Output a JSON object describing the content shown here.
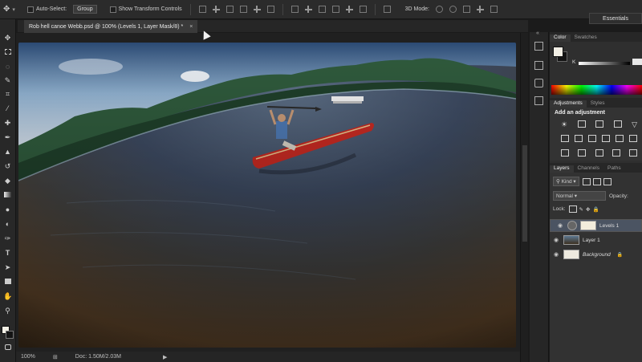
{
  "options_bar": {
    "auto_select_label": "Auto-Select:",
    "target": "Group",
    "transform_label": "Show Transform Controls",
    "mode_label": "3D Mode:",
    "workspace": "Essentials"
  },
  "document": {
    "tab_title": "Rob hell canoe Webb.psd @ 100% (Levels 1, Layer Mask/8) *",
    "close_glyph": "×"
  },
  "status_bar": {
    "zoom": "100%",
    "doc_size": "Doc: 1.50M/2.03M"
  },
  "color_panel": {
    "tabs": [
      "Color",
      "Swatches"
    ],
    "channel_label": "K"
  },
  "adjustments_panel": {
    "tabs": [
      "Adjustments",
      "Styles"
    ],
    "title": "Add an adjustment"
  },
  "layers_panel": {
    "tabs": [
      "Layers",
      "Channels",
      "Paths"
    ],
    "filter": "Kind",
    "blend_mode": "Normal",
    "opacity_label": "Opacity:",
    "lock_label": "Lock:",
    "layers": [
      {
        "name": "Levels 1",
        "selected": true
      },
      {
        "name": "Layer 1",
        "selected": false
      },
      {
        "name": "Background",
        "selected": false
      }
    ]
  },
  "colors": {
    "foreground": "#f2efe5",
    "background": "#141414",
    "canoe": "#c62a22"
  },
  "icons": [
    "move-icon",
    "marquee-icon",
    "lasso-icon",
    "quick-select-icon",
    "crop-icon",
    "eyedropper-icon",
    "healing-icon",
    "brush-icon",
    "stamp-icon",
    "history-brush-icon",
    "eraser-icon",
    "gradient-icon",
    "blur-icon",
    "dodge-icon",
    "pen-icon",
    "type-icon",
    "path-select-icon",
    "shape-icon",
    "hand-icon",
    "zoom-icon"
  ]
}
